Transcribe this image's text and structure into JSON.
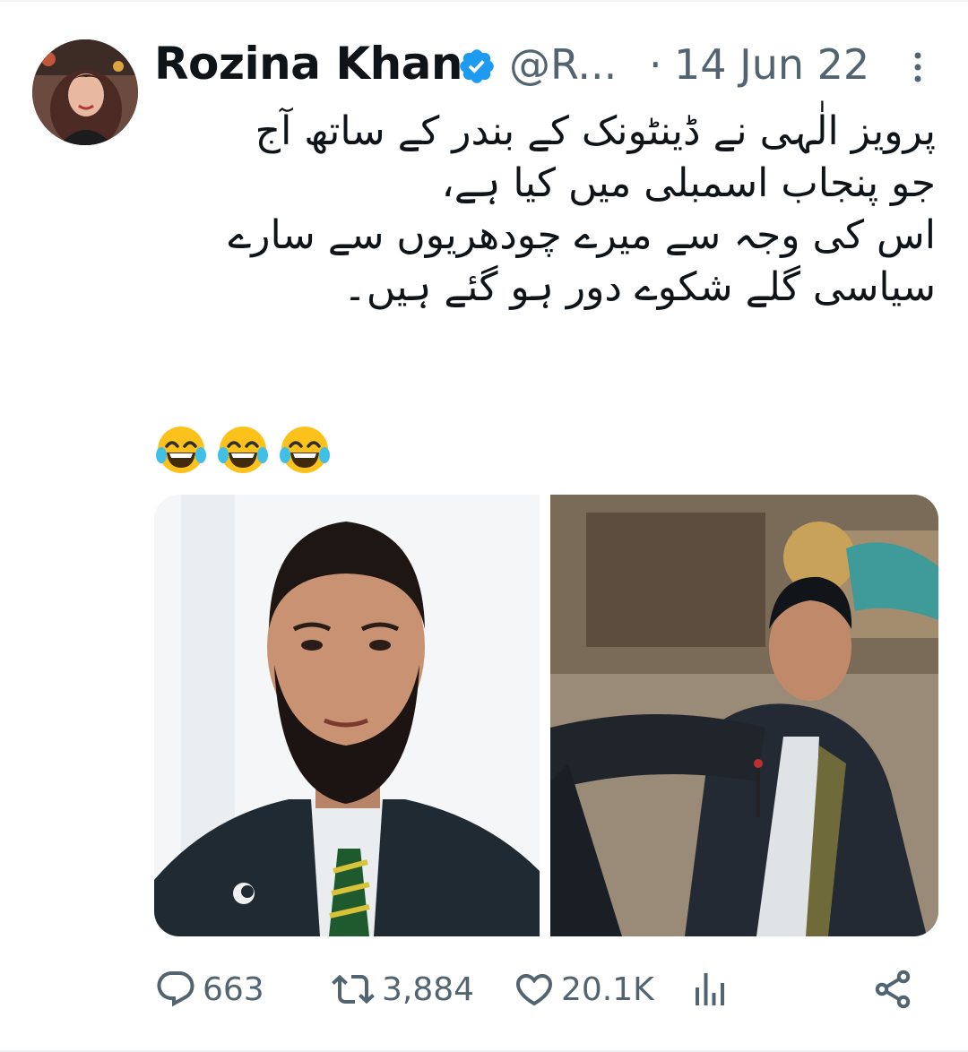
{
  "tweet": {
    "author_name": "Rozina Khan",
    "handle": "@R...",
    "separator": "·",
    "date": "14 Jun 22",
    "text_lines": [
      "پرویز الٰہی نے ڈینٹونک کے بندر کے ساتھ آج",
      "جو پنجاب اسمبلی میں کیا ہے،",
      "اس کی وجہ سے میرے چودھریوں سے سارے",
      "سیاسی گلے شکوے دور ہو گئے ہیں۔"
    ],
    "emoji": [
      "face-with-tears-of-joy",
      "face-with-tears-of-joy",
      "face-with-tears-of-joy"
    ],
    "media": [
      {
        "icon": "portrait-photo"
      },
      {
        "icon": "assembly-scuffle-photo"
      }
    ]
  },
  "actions": {
    "replies": "663",
    "retweets": "3,884",
    "likes": "20.1K"
  },
  "colors": {
    "text": "#0f1419",
    "secondary": "#536471",
    "verified": "#1d9bf0"
  }
}
